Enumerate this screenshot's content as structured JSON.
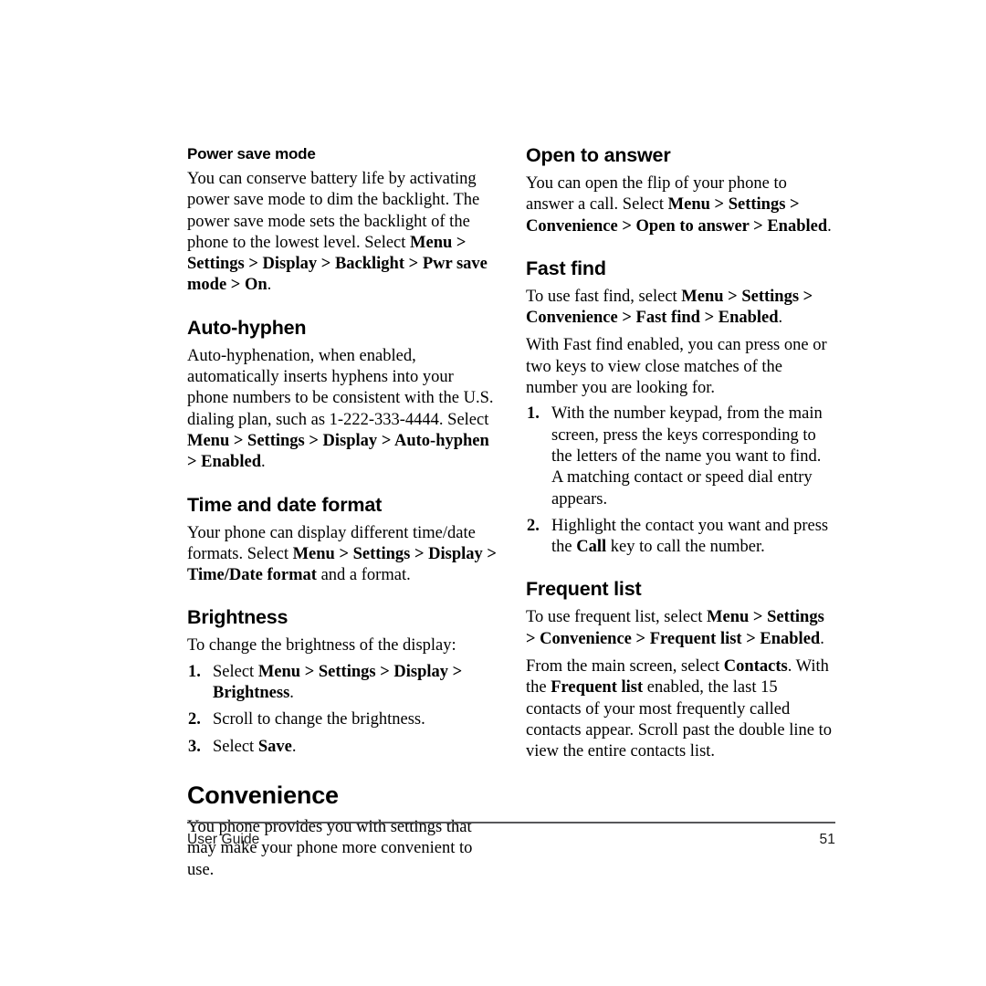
{
  "page": {
    "footer_label": "User Guide",
    "page_number": "51"
  },
  "left_column": {
    "power_save": {
      "heading": "Power save mode",
      "para_plain_1": "You can conserve battery life by activating power save mode to dim the backlight. The power save mode sets the backlight of the phone to the lowest level. Select ",
      "path_menu": "Menu",
      "sep_1": " > ",
      "path_settings": "Settings",
      "sep_2": " > ",
      "path_display": "Display",
      "sep_3": " > ",
      "path_backlight": "Backlight",
      "sep_4": " > ",
      "path_pwr_save": "Pwr save mode",
      "sep_5": " > ",
      "path_on": "On",
      "period": "."
    },
    "auto_hyphen": {
      "heading": "Auto-hyphen",
      "para_plain_1": "Auto-hyphenation, when enabled, automatically inserts hyphens into your phone numbers to be consistent with the U.S. dialing plan, such as 1-222-333-4444. Select ",
      "path_menu": "Menu",
      "sep_1": " > ",
      "path_settings": "Settings",
      "sep_2": " > ",
      "path_display": "Display",
      "sep_3": " > ",
      "path_auto_hyphen": "Auto-hyphen",
      "sep_4": " > ",
      "path_enabled": "Enabled",
      "period": "."
    },
    "time_date": {
      "heading": "Time and date format",
      "para_plain_1": "Your phone can display different time/date formats. Select ",
      "path_menu": "Menu",
      "sep_1": " > ",
      "path_settings": "Settings",
      "sep_2": " > ",
      "path_display": "Display",
      "sep_3": " > ",
      "path_time_date": "Time/Date format",
      "tail": " and a format."
    },
    "brightness": {
      "heading": "Brightness",
      "intro": "To change the brightness of the display:",
      "steps": [
        {
          "marker": "1.",
          "plain_1": "Select ",
          "path_menu": "Menu",
          "sep_1": " > ",
          "path_settings": "Settings",
          "sep_2": " > ",
          "path_display": "Display",
          "sep_3": " > ",
          "path_brightness": "Brightness",
          "period": "."
        },
        {
          "marker": "2.",
          "text": "Scroll to change the brightness."
        },
        {
          "marker": "3.",
          "plain_1": "Select ",
          "path_save": "Save",
          "period": "."
        }
      ]
    },
    "convenience": {
      "heading": "Convenience",
      "para": "You phone provides you with settings that may make your phone more convenient to use."
    }
  },
  "right_column": {
    "open_to_answer": {
      "heading": "Open to answer",
      "para_plain_1": "You can open the flip of your phone to answer a call. Select ",
      "path_menu": "Menu",
      "sep_1": " > ",
      "path_settings": "Settings",
      "sep_2": " > ",
      "path_convenience": "Convenience",
      "sep_3": " > ",
      "path_open_to_answer": "Open to answer",
      "sep_4": " > ",
      "path_enabled": "Enabled",
      "period": "."
    },
    "fast_find": {
      "heading": "Fast find",
      "para_plain_1": "To use fast find, select ",
      "path_menu": "Menu",
      "sep_1": " > ",
      "path_settings": "Settings",
      "sep_2": " > ",
      "path_convenience": "Convenience",
      "sep_3": " > ",
      "path_fast_find": "Fast find",
      "sep_4": " > ",
      "path_enabled": "Enabled",
      "period": ".",
      "para_2": "With Fast find enabled, you can press one or two keys to view close matches of the number you are looking for.",
      "steps": [
        {
          "marker": "1.",
          "text": "With the number keypad, from the main screen, press the keys corresponding to the letters of the name you want to find. A matching contact or speed dial entry appears."
        },
        {
          "marker": "2.",
          "plain_1": "Highlight the contact you want and press the ",
          "path_call": "Call",
          "tail": " key to call the number."
        }
      ]
    },
    "frequent_list": {
      "heading": "Frequent list",
      "para_plain_1": "To use frequent list, select ",
      "path_menu": "Menu",
      "sep_1": " > ",
      "path_settings": "Settings",
      "sep_2": " > ",
      "path_convenience": "Convenience",
      "sep_3": " > ",
      "path_frequent_list": "Frequent list",
      "sep_4": " > ",
      "path_enabled": "Enabled",
      "period": ".",
      "para2_plain_1": "From the main screen, select ",
      "para2_contacts": "Contacts",
      "para2_mid": ". With the ",
      "para2_frequent_list": "Frequent list",
      "para2_tail": " enabled, the last 15 contacts of your most frequently called contacts appear. Scroll past the double line to view the entire contacts list."
    }
  }
}
